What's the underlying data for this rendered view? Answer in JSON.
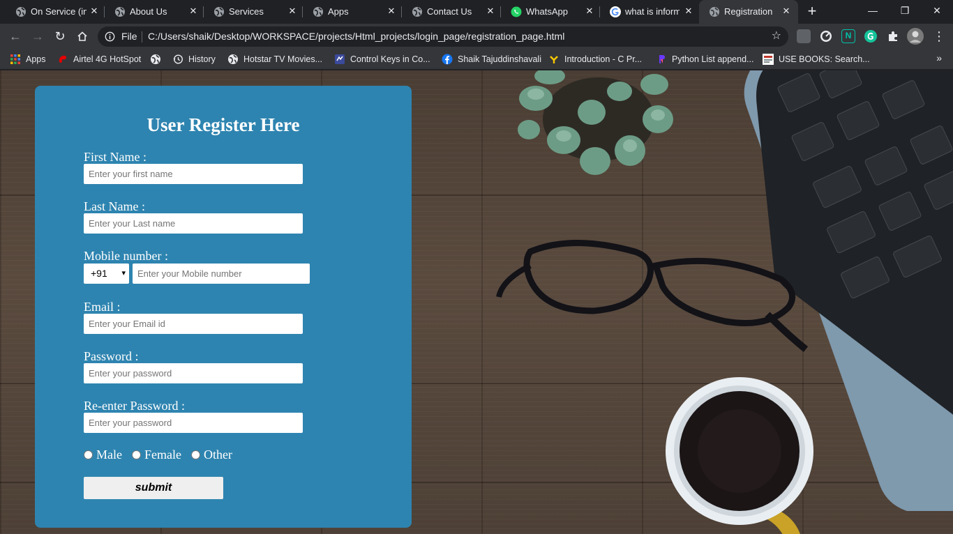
{
  "tabs": [
    {
      "title": "On Service (inc",
      "favicon": "globe-icon"
    },
    {
      "title": "About Us",
      "favicon": "globe-icon"
    },
    {
      "title": "Services",
      "favicon": "globe-icon"
    },
    {
      "title": "Apps",
      "favicon": "globe-icon"
    },
    {
      "title": "Contact Us",
      "favicon": "globe-icon"
    },
    {
      "title": "WhatsApp",
      "favicon": "whatsapp-icon"
    },
    {
      "title": "what is inform",
      "favicon": "google-icon"
    },
    {
      "title": "Registration pa",
      "favicon": "globe-icon",
      "active": true
    }
  ],
  "toolbar": {
    "scheme": "File",
    "url": "C:/Users/shaik/Desktop/WORKSPACE/projects/Html_projects/login_page/registration_page.html"
  },
  "bookmarks": [
    {
      "label": "Apps",
      "icon": "apps-grid-icon"
    },
    {
      "label": "Airtel 4G HotSpot",
      "icon": "airtel-icon"
    },
    {
      "label": "",
      "icon": "globe-icon"
    },
    {
      "label": "History",
      "icon": "history-icon"
    },
    {
      "label": "Hotstar TV Movies...",
      "icon": "globe-icon"
    },
    {
      "label": "Control Keys in Co...",
      "icon": "site-icon"
    },
    {
      "label": "Shaik Tajuddinshavali",
      "icon": "facebook-icon"
    },
    {
      "label": "Introduction - C Pr...",
      "icon": "site-icon"
    },
    {
      "label": "Python List append...",
      "icon": "site-icon"
    },
    {
      "label": "USE BOOKS: Search...",
      "icon": "site-icon"
    }
  ],
  "form": {
    "title": "User Register Here",
    "first_name_label": "First Name :",
    "first_name_placeholder": "Enter your first name",
    "last_name_label": "Last Name :",
    "last_name_placeholder": "Enter your Last name",
    "mobile_label": "Mobile number :",
    "country_code": "+91",
    "mobile_placeholder": "Enter your Mobile number",
    "email_label": "Email :",
    "email_placeholder": "Enter your Email id",
    "password_label": "Password :",
    "password_placeholder": "Enter your password",
    "reenter_label": "Re-enter Password :",
    "reenter_placeholder": "Enter your password",
    "genders": [
      "Male",
      "Female",
      "Other"
    ],
    "submit_label": "submit"
  },
  "colors": {
    "card": "#2e84b0",
    "chrome_dark": "#202124",
    "chrome_toolbar": "#35363a"
  }
}
